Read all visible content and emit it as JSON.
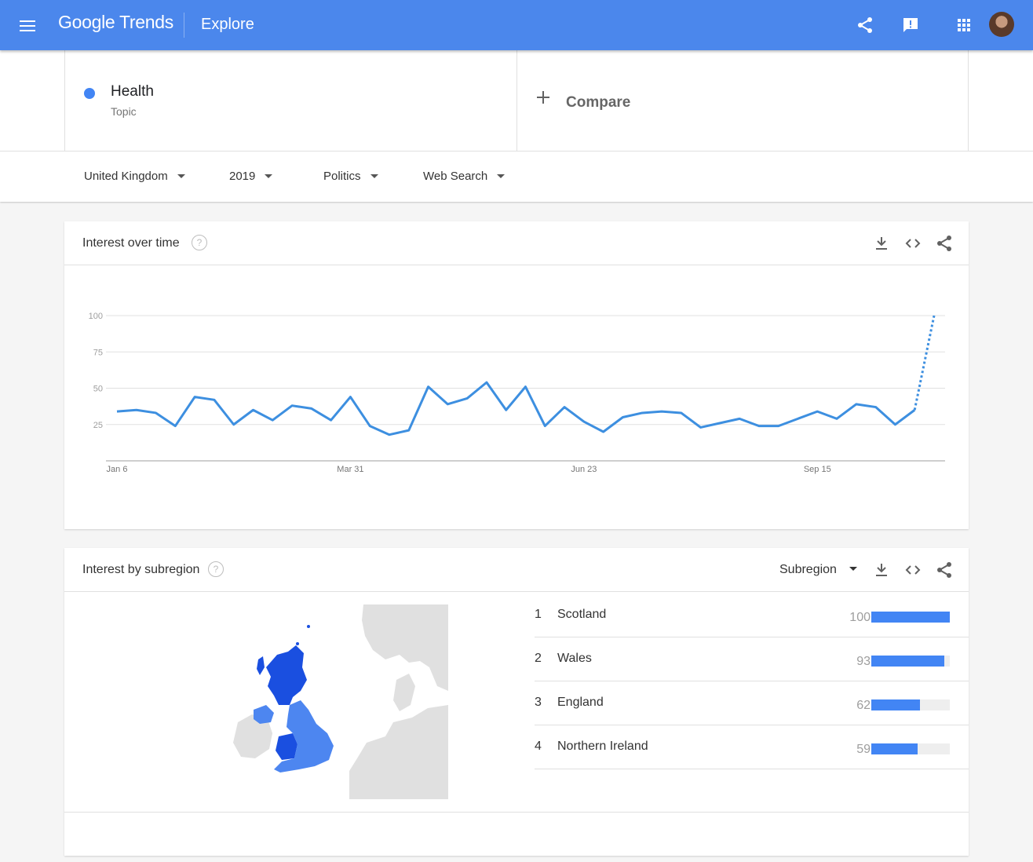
{
  "header": {
    "logo": "Google Trends",
    "page": "Explore"
  },
  "search": {
    "term": {
      "name": "Health",
      "type": "Topic",
      "color": "#4285f4"
    },
    "compare_label": "Compare"
  },
  "filters": {
    "region": "United Kingdom",
    "period": "2019",
    "category": "Politics",
    "property": "Web Search"
  },
  "interest_over_time": {
    "title": "Interest over time",
    "help": "?"
  },
  "chart_data": {
    "type": "line",
    "x_ticks": [
      "Jan 6",
      "Mar 31",
      "Jun 23",
      "Sep 15"
    ],
    "y_ticks": [
      25,
      50,
      75,
      100
    ],
    "ylim": [
      0,
      100
    ],
    "grid": true,
    "series": [
      {
        "color": "#4285f4",
        "values": [
          34,
          35,
          33,
          24,
          44,
          42,
          25,
          35,
          28,
          38,
          36,
          28,
          44,
          24,
          18,
          21,
          51,
          39,
          43,
          54,
          35,
          51,
          24,
          37,
          27,
          20,
          30,
          33,
          34,
          33,
          23,
          26,
          29,
          24,
          24,
          29,
          34,
          29,
          39,
          37,
          25,
          35,
          100
        ],
        "partial_from_index": 41
      }
    ]
  },
  "interest_by_subregion": {
    "title": "Interest by subregion",
    "help": "?",
    "resolution": "Subregion",
    "rows": [
      {
        "rank": "1",
        "name": "Scotland",
        "value": 100
      },
      {
        "rank": "2",
        "name": "Wales",
        "value": 93
      },
      {
        "rank": "3",
        "name": "England",
        "value": 62
      },
      {
        "rank": "4",
        "name": "Northern Ireland",
        "value": 59
      }
    ],
    "colors": {
      "dark": "#1a4fe0",
      "light": "#4d86f0",
      "land": "#e0e0e0",
      "sea": "#ffffff"
    }
  }
}
